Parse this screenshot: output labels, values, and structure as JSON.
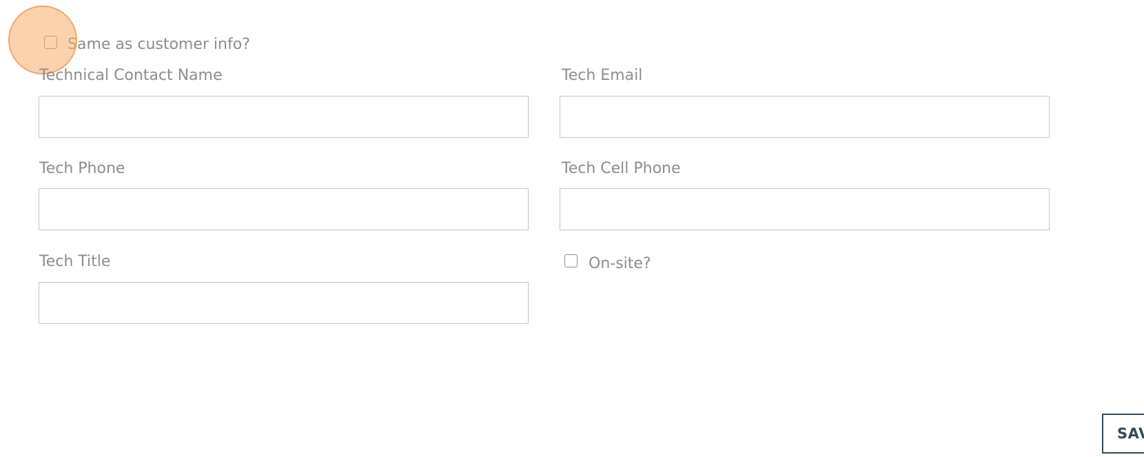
{
  "form": {
    "same_as_customer": {
      "label": "Same as customer info?",
      "checked": false
    },
    "technical_contact_name": {
      "label": "Technical Contact Name",
      "value": "",
      "placeholder": ""
    },
    "tech_email": {
      "label": "Tech Email",
      "value": "",
      "placeholder": ""
    },
    "tech_phone": {
      "label": "Tech Phone",
      "value": "",
      "placeholder": ""
    },
    "tech_cell_phone": {
      "label": "Tech Cell Phone",
      "value": "",
      "placeholder": ""
    },
    "tech_title": {
      "label": "Tech Title",
      "value": "",
      "placeholder": ""
    },
    "on_site": {
      "label": "On-site?",
      "checked": false
    }
  },
  "actions": {
    "save_label": "SAVE"
  },
  "colors": {
    "label_text": "#8d8d8d",
    "field_border": "#c6c6c6",
    "save_border": "#2f4b55",
    "click_highlight": "#f8ad69"
  }
}
